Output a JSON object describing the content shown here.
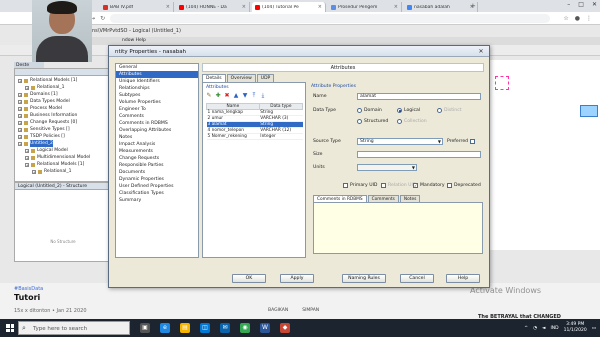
{
  "browser": {
    "tabs": [
      {
        "title": "BAB IV.pdf",
        "color": "#d93025"
      },
      {
        "title": "(104) HONNE - Da",
        "color": "#ff0000"
      },
      {
        "title": "(104) Tutorial Pe",
        "color": "#ff0000"
      },
      {
        "title": "Prosedur Pengem",
        "color": "#5c8ee6"
      },
      {
        "title": "nasabah adalah",
        "color": "#4285f4"
      }
    ],
    "new_tab": "+",
    "window_controls": [
      "–",
      "□",
      "✕"
    ]
  },
  "sqldev": {
    "window_title": "ns\\VMrPvtdSO",
    "subtitle": "- Logical (Untitled_1)",
    "menu": "ndow  Help",
    "navigator_title": "Deste",
    "tree": [
      {
        "label": "Relational Models [1]",
        "level": 0
      },
      {
        "label": "Relational_1",
        "level": 1
      },
      {
        "label": "Domains [1]",
        "level": 0
      },
      {
        "label": "Data Types Model",
        "level": 0
      },
      {
        "label": "Process Model",
        "level": 0
      },
      {
        "label": "Business Information",
        "level": 0
      },
      {
        "label": "Change Requests [0]",
        "level": 0
      },
      {
        "label": "Sensitive Types []",
        "level": 0
      },
      {
        "label": "TSDP Policies []",
        "level": 0
      },
      {
        "label": "Untitled_2",
        "level": 0,
        "selected": true
      },
      {
        "label": "Logical Model",
        "level": 1
      },
      {
        "label": "Multidimensional Model",
        "level": 1
      },
      {
        "label": "Relational Models [1]",
        "level": 1
      },
      {
        "label": "Relational_1",
        "level": 2
      }
    ],
    "structure_title": "Logical (Untitled_2) - Structure",
    "no_structure": "No Structure",
    "watermark": "Activate Windows",
    "next_video": "The BETRAYAL that CHANGED"
  },
  "youtube": {
    "tag": "#BasisData",
    "title": "Tutori",
    "meta": "15x x ditonton • Jan 21 2020",
    "actions": [
      "",
      "",
      "BAGIKAN",
      "SIMPAN",
      ""
    ]
  },
  "dialog": {
    "title": "ntity Properties - nasabah",
    "close": "✕",
    "categories": [
      "General",
      "Attributes",
      "Unique Identifiers",
      "Relationships",
      "Subtypes",
      "Volume Properties",
      "Engineer To",
      "Comments",
      "Comments in RDBMS",
      "Overlapping Attributes",
      "Notes",
      "Impact Analysis",
      "Measurements",
      "Change Requests",
      "Responsible Parties",
      "Documents",
      "Dynamic Properties",
      "User Defined Properties",
      "Classification Types",
      "Summary"
    ],
    "selected_category": 1,
    "header": "Attributes",
    "tabs": [
      "Details",
      "Overview",
      "UDP"
    ],
    "attributes_label": "Attributes",
    "toolbar_icons": [
      "edit-icon",
      "add-icon",
      "delete-icon",
      "up-icon",
      "down-icon",
      "top-icon",
      "bottom-icon"
    ],
    "table": {
      "columns": [
        "Name",
        "Data type"
      ],
      "rows": [
        {
          "name": "1 nama_lengkap",
          "type": "String"
        },
        {
          "name": "2 umur",
          "type": "VARCHAR (3)"
        },
        {
          "name": "3 alamat",
          "type": "String",
          "selected": true
        },
        {
          "name": "4 nomor_telepon",
          "type": "VARCHAR (12)"
        },
        {
          "name": "5 Nomer_rekening",
          "type": "Integer"
        }
      ]
    },
    "props": {
      "heading": "Attribute Properties",
      "name_label": "Name",
      "name_value": "alamat",
      "datatype_label": "Data Type",
      "datatype_options": [
        {
          "label": "Domain",
          "on": false,
          "disabled": false
        },
        {
          "label": "Logical",
          "on": true,
          "disabled": false
        },
        {
          "label": "Distinct",
          "on": false,
          "disabled": true
        },
        {
          "label": "Structured",
          "on": false,
          "disabled": false
        },
        {
          "label": "Collection",
          "on": false,
          "disabled": true
        }
      ],
      "sourcetype_label": "Source Type",
      "sourcetype_value": "String",
      "preferred_label": "Preferred",
      "size_label": "Size",
      "size_value": "",
      "units_label": "Units",
      "units_value": "",
      "primary_uid": "Primary UID",
      "relation_uid": "Relation UID",
      "mandatory": "Mandatory",
      "deprecated": "Deprecated",
      "comment_tabs": [
        "Comments in RDBMS",
        "Comments",
        "Notes"
      ]
    },
    "buttons": {
      "ok": "OK",
      "apply": "Apply",
      "naming_rules": "Naming Rules",
      "cancel": "Cancel",
      "help": "Help"
    }
  },
  "taskbar": {
    "search_placeholder": "Type here to search",
    "apps": [
      "task-view",
      "edge",
      "explorer",
      "store",
      "mail",
      "chrome",
      "word",
      "sqldev"
    ],
    "app_colors": [
      "#555",
      "#1e88e5",
      "#f4b400",
      "#0078d4",
      "#0a64ad",
      "#34a853",
      "#2b579a",
      "#c74634"
    ],
    "lang": "IND",
    "time": "3:49 PM",
    "date": "11/1/2020"
  }
}
